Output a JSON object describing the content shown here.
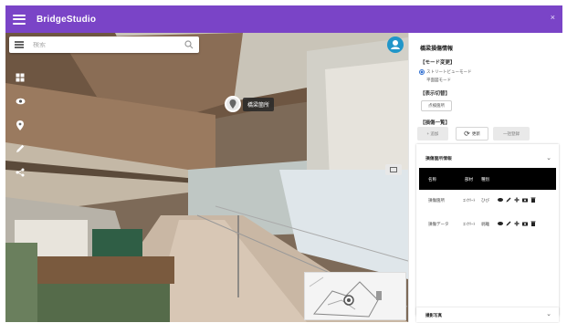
{
  "app": {
    "title": "BridgeStudio",
    "close_glyph": "×"
  },
  "search": {
    "placeholder": "検索"
  },
  "viewer": {
    "marker_label": "橋梁箇所",
    "tools": [
      "layers-icon",
      "eye-icon",
      "location-pin-icon",
      "pen-icon",
      "share-icon"
    ]
  },
  "panel": {
    "title": "橋梁損傷情報",
    "section_mode": "【モード変更】",
    "radio_1": "ストリートビューモード",
    "radio_2": "平面図モード",
    "section_info": "【表示切替】",
    "chip_label": "点検箇所",
    "section_list": "【損傷一覧】",
    "tab_1": "+ 追加",
    "tab_2": "更新",
    "tab_3": "一括登録",
    "card_title": "損傷箇所情報",
    "table_headers": [
      "名称",
      "部材",
      "種別"
    ],
    "rows": [
      {
        "name": "損傷箇所",
        "member": "ｺﾝｸﾘｰﾄ",
        "type": "ひび"
      },
      {
        "name": "損傷データ",
        "member": "ｺﾝｸﾘｰﾄ",
        "type": "剥離"
      }
    ],
    "footer_label": "撮影写真"
  },
  "colors": {
    "accent": "#7a44c7",
    "avatar": "#2196c9"
  }
}
